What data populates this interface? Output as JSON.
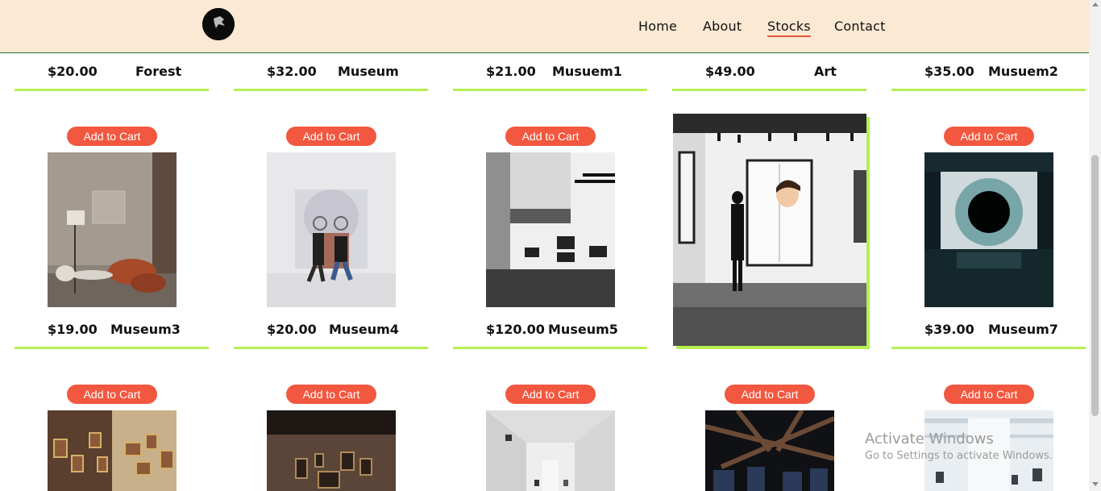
{
  "nav": {
    "items": [
      "Home",
      "About",
      "Stocks",
      "Contact"
    ],
    "active": "Stocks"
  },
  "row1": [
    {
      "price": "$20.00",
      "name": "Forest"
    },
    {
      "price": "$32.00",
      "name": "Museum"
    },
    {
      "price": "$21.00",
      "name": "Musuem1"
    },
    {
      "price": "$49.00",
      "name": "Art"
    },
    {
      "price": "$35.00",
      "name": "Musuem2"
    }
  ],
  "row2": [
    {
      "price": "$19.00",
      "name": "Museum3"
    },
    {
      "price": "$20.00",
      "name": "Museum4"
    },
    {
      "price": "$120.00",
      "name": "Museum5"
    },
    {
      "price": "",
      "name": ""
    },
    {
      "price": "$39.00",
      "name": "Museum7"
    }
  ],
  "cart_label": "Add to Cart",
  "watermark": {
    "title": "Activate Windows",
    "subtitle": "Go to Settings to activate Windows."
  },
  "colors": {
    "header_bg": "#fbe9d4",
    "accent_underline": "#b6ef52",
    "button": "#f2573f",
    "nav_active": "#e35a3a"
  },
  "icons": [
    "logo-icon"
  ]
}
